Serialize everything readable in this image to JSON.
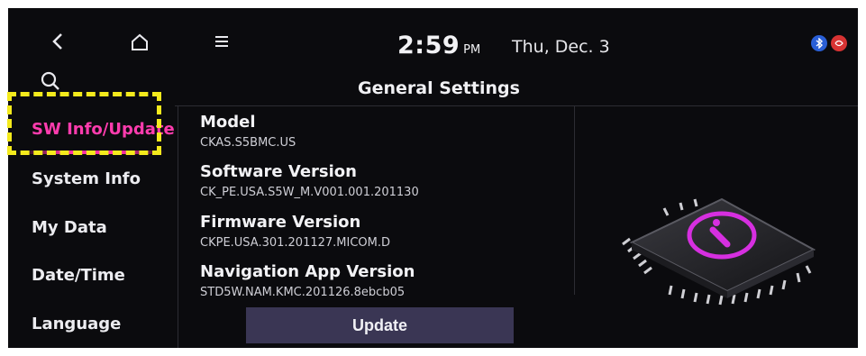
{
  "clock": {
    "time": "2:59",
    "ampm": "PM"
  },
  "date": "Thu, Dec. 3",
  "page_title": "General Settings",
  "sidebar": {
    "items": [
      {
        "label": "SW Info/Update",
        "active": true
      },
      {
        "label": "System Info",
        "active": false
      },
      {
        "label": "My Data",
        "active": false
      },
      {
        "label": "Date/Time",
        "active": false
      },
      {
        "label": "Language",
        "active": false
      }
    ]
  },
  "info": {
    "model_label": "Model",
    "model_value": "CKAS.S5BMC.US",
    "software_label": "Software Version",
    "software_value": "CK_PE.USA.S5W_M.V001.001.201130",
    "firmware_label": "Firmware Version",
    "firmware_value": "CKPE.USA.301.201127.MICOM.D",
    "nav_label": "Navigation App Version",
    "nav_value": "STD5W.NAM.KMC.201126.8ebcb05"
  },
  "update_button": "Update",
  "icons": {
    "back": "back-arrow-icon",
    "home": "home-icon",
    "menu": "menu-icon",
    "search": "search-icon",
    "status": [
      "bluetooth-icon",
      "voice-icon"
    ],
    "graphic": "chip-info-icon"
  },
  "colors": {
    "accent": "#ff3cae",
    "highlight": "#f4ea1c",
    "background": "#0b0b0e",
    "button": "#3a3654"
  }
}
